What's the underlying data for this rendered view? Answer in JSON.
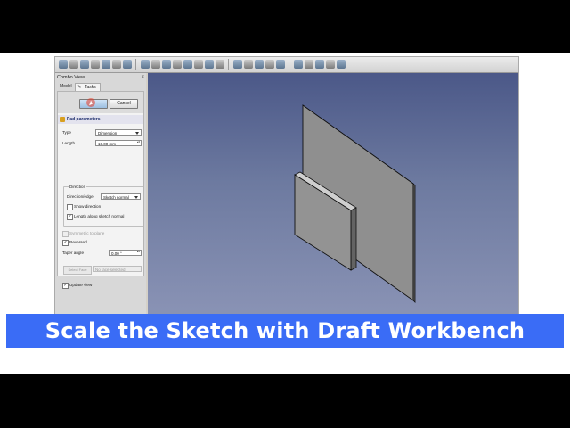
{
  "combo_view": {
    "title": "Combo View",
    "close_label": "×",
    "tabs": {
      "model": "Model",
      "tasks": "Tasks"
    }
  },
  "dialog": {
    "ok_label": "",
    "cancel_label": "Cancel"
  },
  "pad": {
    "section_title": "Pad parameters",
    "type_label": "Type",
    "type_value": "Dimension",
    "length_label": "Length",
    "length_value": "10.00 mm",
    "direction_group": "Direction",
    "direction_edge_label": "Direction/edge:",
    "direction_edge_value": "Sketch normal",
    "show_direction_label": "Show direction",
    "show_direction_checked": false,
    "length_along_normal_label": "Length along sketch normal",
    "length_along_normal_checked": true,
    "symmetric_label": "Symmetric to plane",
    "symmetric_checked": false,
    "reversed_label": "Reversed",
    "reversed_checked": true,
    "taper_label": "Taper angle",
    "taper_value": "0.00 °",
    "select_face_label": "Select Face",
    "face_value": "No face selected",
    "update_view_label": "Update view",
    "update_view_checked": true
  },
  "caption": {
    "text": "Scale the Sketch with Draft Workbench"
  },
  "colors": {
    "caption_bg": "#3a6cf6",
    "viewport_top": "#4b5888",
    "viewport_bottom": "#8a93b5",
    "solid_face": "#909090"
  }
}
